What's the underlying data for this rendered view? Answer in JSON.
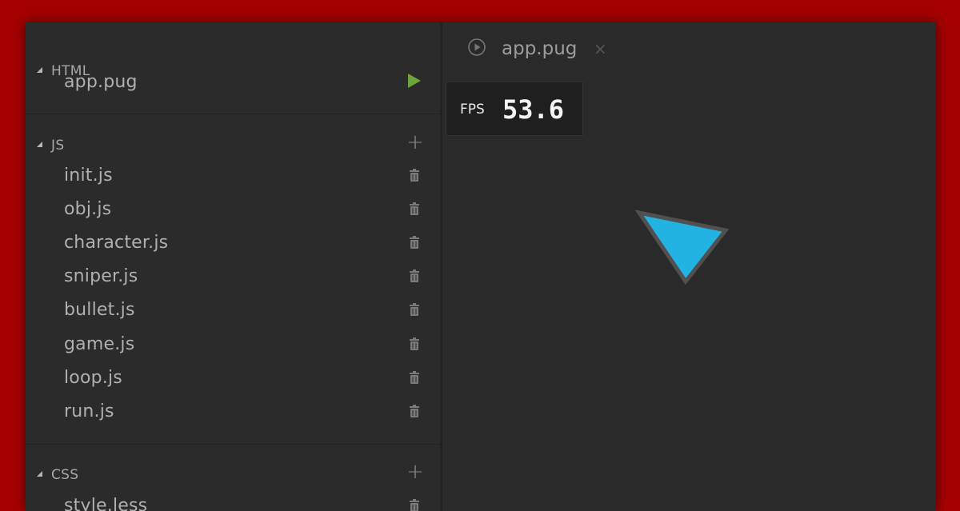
{
  "sidebar": {
    "html_section": {
      "label": "HTML",
      "files": [
        {
          "name": "app.pug"
        }
      ]
    },
    "js_section": {
      "label": "JS",
      "files": [
        {
          "name": "init.js"
        },
        {
          "name": "obj.js"
        },
        {
          "name": "character.js"
        },
        {
          "name": "sniper.js"
        },
        {
          "name": "bullet.js"
        },
        {
          "name": "game.js"
        },
        {
          "name": "loop.js"
        },
        {
          "name": "run.js"
        }
      ]
    },
    "css_section": {
      "label": "CSS",
      "files": [
        {
          "name": "style.less"
        }
      ]
    }
  },
  "editor": {
    "tab_label": "app.pug",
    "tab_close": "×"
  },
  "fps_meter": {
    "label": "FPS",
    "value": "53.6"
  },
  "colors": {
    "background": "#a50000",
    "panel": "#2a2a2a",
    "run_accent": "#6aa43a",
    "player_fill": "#22b3e3",
    "player_stroke": "#505050"
  }
}
